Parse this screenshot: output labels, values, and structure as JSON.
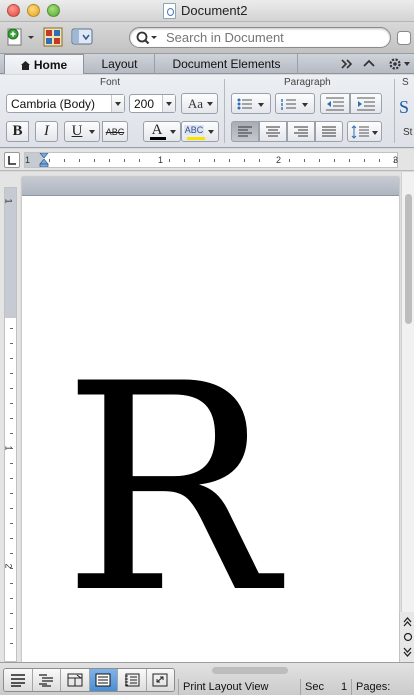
{
  "window": {
    "title": "Document2"
  },
  "search": {
    "placeholder": "Search in Document"
  },
  "ribbon_tabs": {
    "home": "Home",
    "layout": "Layout",
    "document_elements": "Document Elements"
  },
  "ribbon": {
    "font_group_title": "Font",
    "paragraph_group_title": "Paragraph",
    "styles_group_title": "S",
    "font_name": "Cambria (Body)",
    "font_size": "200",
    "aa_label": "Aa",
    "bold_label": "B",
    "italic_label": "I",
    "underline_label": "U",
    "strike_label": "ABC",
    "font_color_label": "A",
    "highlight_label": "ABC",
    "styles_preview": "S",
    "styles_caption": "St"
  },
  "colors": {
    "font_color_bar": "#000000",
    "highlight_color_bar": "#f5e400",
    "accent": "#4b8dd4"
  },
  "ruler": {
    "marks": [
      "1",
      "1",
      "2",
      "3"
    ]
  },
  "vertical_ruler": {
    "marks": [
      "1",
      "1",
      "2"
    ]
  },
  "document": {
    "content": "R"
  },
  "status": {
    "view": "Print Layout View",
    "section_label": "Sec",
    "section_value": "1",
    "pages_label": "Pages:"
  }
}
